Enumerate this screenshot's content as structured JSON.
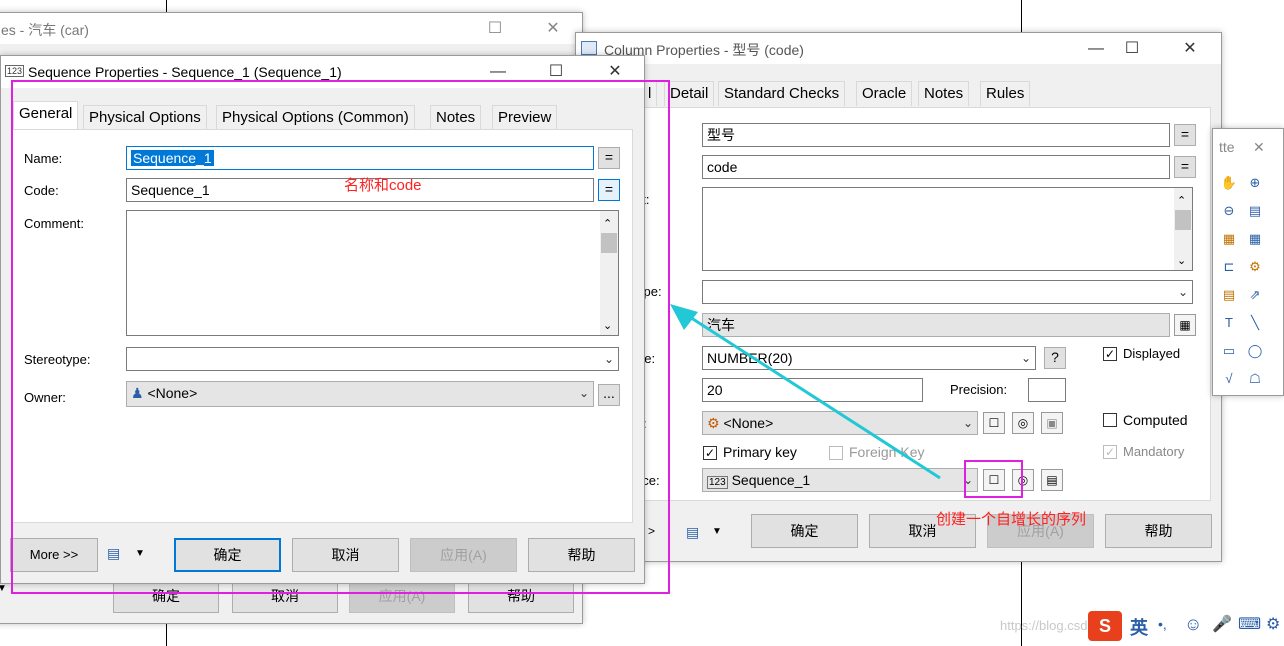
{
  "back_window": {
    "title": "es - 汽车 (car)",
    "buttons": {
      "ok": "确定",
      "cancel": "取消",
      "apply": "应用(A)",
      "help": "帮助"
    }
  },
  "sequence_window": {
    "title": "Sequence Properties - Sequence_1 (Sequence_1)",
    "tabs": [
      "General",
      "Physical Options",
      "Physical Options (Common)",
      "Notes",
      "Preview"
    ],
    "name_label": "Name:",
    "name_value": "Sequence_1",
    "code_label": "Code:",
    "code_value": "Sequence_1",
    "comment_label": "Comment:",
    "stereotype_label": "Stereotype:",
    "owner_label": "Owner:",
    "owner_value": "<None>",
    "eq": "=",
    "ellipsis": "...",
    "buttons": {
      "more": "More >>",
      "ok": "确定",
      "cancel": "取消",
      "apply": "应用(A)",
      "help": "帮助"
    }
  },
  "column_window": {
    "title": "Column Properties - 型号 (code)",
    "tabs": [
      "l",
      "Detail",
      "Standard Checks",
      "Oracle",
      "Notes",
      "Rules"
    ],
    "name_value": "型号",
    "code_value": "code",
    "eq": "=",
    "labels": {
      "comment": "nt:",
      "type": "ype:",
      "datatype": "pe:",
      "domain": ":",
      "sequence": "nce:"
    },
    "table_value": "汽车",
    "datatype_value": "NUMBER(20)",
    "help_q": "?",
    "length_value": "20",
    "precision_label": "Precision:",
    "domain_value": "<None>",
    "checks": {
      "displayed": "Displayed",
      "computed": "Computed",
      "primary_key": "Primary key",
      "foreign_key": "Foreign Key",
      "mandatory": "Mandatory"
    },
    "sequence_value": "Sequence_1",
    "buttons": {
      "more": ">",
      "ok": "确定",
      "cancel": "取消",
      "apply": "应用(A)",
      "help": "帮助"
    }
  },
  "palette": {
    "title": "tte"
  },
  "annotations": {
    "name_code_note": "名称和code",
    "create_sequence_note": "创建一个自增长的序列"
  },
  "watermark": "https://blog.csdn.net",
  "ime_lang": "英",
  "colors": {
    "annotation_box": "#e020e0",
    "arrow": "#22c8d6",
    "note_text": "#ff2020",
    "selection": "#0078d7"
  }
}
